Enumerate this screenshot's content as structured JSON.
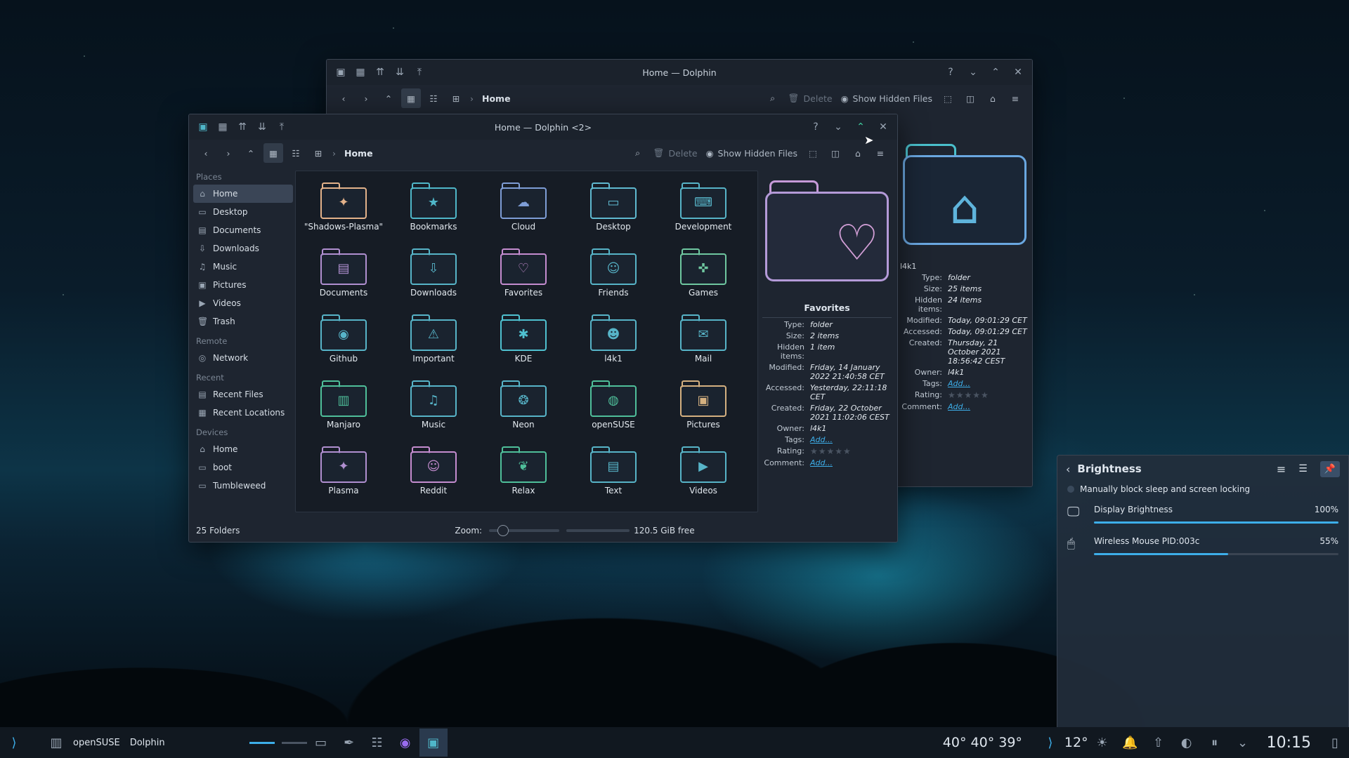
{
  "back_window": {
    "title": "Home — Dolphin",
    "breadcrumb": "Home",
    "delete_label": "Delete",
    "hidden_label": "Show Hidden Files",
    "info": {
      "name": "l4k1",
      "rows": [
        {
          "k": "Type:",
          "v": "folder"
        },
        {
          "k": "Size:",
          "v": "25 items"
        },
        {
          "k": "Hidden items:",
          "v": "24 items"
        },
        {
          "k": "Modified:",
          "v": "Today, 09:01:29 CET"
        },
        {
          "k": "Accessed:",
          "v": "Today, 09:01:29 CET"
        },
        {
          "k": "Created:",
          "v": "Thursday, 21 October 2021 18:56:42 CEST"
        },
        {
          "k": "Owner:",
          "v": "l4k1"
        },
        {
          "k": "Tags:",
          "v": "Add..."
        },
        {
          "k": "Rating:",
          "v": "★★★★★"
        },
        {
          "k": "Comment:",
          "v": "Add..."
        }
      ]
    }
  },
  "window": {
    "title": "Home — Dolphin <2>",
    "breadcrumb": "Home",
    "delete_label": "Delete",
    "hidden_label": "Show Hidden Files"
  },
  "places": {
    "sections": [
      {
        "title": "Places",
        "items": [
          "Home",
          "Desktop",
          "Documents",
          "Downloads",
          "Music",
          "Pictures",
          "Videos",
          "Trash"
        ]
      },
      {
        "title": "Remote",
        "items": [
          "Network"
        ]
      },
      {
        "title": "Recent",
        "items": [
          "Recent Files",
          "Recent Locations"
        ]
      },
      {
        "title": "Devices",
        "items": [
          "Home",
          "boot",
          "Tumbleweed"
        ]
      }
    ]
  },
  "folders": [
    {
      "name": "\"Shadows-Plasma\"",
      "glyph": "✦",
      "color": "#e3b28a"
    },
    {
      "name": "Bookmarks",
      "glyph": "★",
      "color": "#4fb7c9"
    },
    {
      "name": "Cloud",
      "glyph": "☁",
      "color": "#7e9dd6"
    },
    {
      "name": "Desktop",
      "glyph": "▭",
      "color": "#5fb9d0"
    },
    {
      "name": "Development",
      "glyph": "⌨",
      "color": "#57b4c8"
    },
    {
      "name": "Documents",
      "glyph": "▤",
      "color": "#b08fd0"
    },
    {
      "name": "Downloads",
      "glyph": "⇩",
      "color": "#57b4c8"
    },
    {
      "name": "Favorites",
      "glyph": "♡",
      "color": "#c48ccf"
    },
    {
      "name": "Friends",
      "glyph": "☺",
      "color": "#57b4c8"
    },
    {
      "name": "Games",
      "glyph": "✜",
      "color": "#6fc7a0"
    },
    {
      "name": "Github",
      "glyph": "◉",
      "color": "#57b4c8"
    },
    {
      "name": "Important",
      "glyph": "⚠",
      "color": "#57b4c8"
    },
    {
      "name": "KDE",
      "glyph": "✱",
      "color": "#4fc1d0"
    },
    {
      "name": "l4k1",
      "glyph": "☻",
      "color": "#57b4c8"
    },
    {
      "name": "Mail",
      "glyph": "✉",
      "color": "#57b4c8"
    },
    {
      "name": "Manjaro",
      "glyph": "▥",
      "color": "#4fbf9a"
    },
    {
      "name": "Music",
      "glyph": "♫",
      "color": "#57b4c8"
    },
    {
      "name": "Neon",
      "glyph": "❂",
      "color": "#57b4c8"
    },
    {
      "name": "openSUSE",
      "glyph": "◍",
      "color": "#4fbf9a"
    },
    {
      "name": "Pictures",
      "glyph": "▣",
      "color": "#d4b080"
    },
    {
      "name": "Plasma",
      "glyph": "✦",
      "color": "#b08fd0"
    },
    {
      "name": "Reddit",
      "glyph": "☺",
      "color": "#c48ccf"
    },
    {
      "name": "Relax",
      "glyph": "❦",
      "color": "#4fbf9a"
    },
    {
      "name": "Text",
      "glyph": "▤",
      "color": "#57b4c8"
    },
    {
      "name": "Videos",
      "glyph": "▶",
      "color": "#57b4c8"
    }
  ],
  "info": {
    "name": "Favorites",
    "rows": [
      {
        "k": "Type:",
        "v": "folder"
      },
      {
        "k": "Size:",
        "v": "2 items"
      },
      {
        "k": "Hidden items:",
        "v": "1 item"
      },
      {
        "k": "Modified:",
        "v": "Friday, 14 January 2022 21:40:58 CET"
      },
      {
        "k": "Accessed:",
        "v": "Yesterday, 22:11:18 CET"
      },
      {
        "k": "Created:",
        "v": "Friday, 22 October 2021 11:02:06 CEST"
      },
      {
        "k": "Owner:",
        "v": "l4k1"
      },
      {
        "k": "Tags:",
        "v": "Add..."
      },
      {
        "k": "Rating:",
        "v": "★★★★★"
      },
      {
        "k": "Comment:",
        "v": "Add..."
      }
    ]
  },
  "status": {
    "count": "25 Folders",
    "zoom_label": "Zoom:",
    "free": "120.5 GiB free"
  },
  "brightness": {
    "title": "Brightness",
    "inhibit": "Manually block sleep and screen locking",
    "items": [
      {
        "name": "Display Brightness",
        "value": "100%",
        "level": 1.0
      },
      {
        "name": "Wireless Mouse PID:003c",
        "value": "55%",
        "level": 0.55
      }
    ]
  },
  "taskbar": {
    "task1": "openSUSE",
    "task2": "Dolphin",
    "temps": "40° 40° 39°",
    "weather": "12°",
    "clock": "10:15"
  }
}
